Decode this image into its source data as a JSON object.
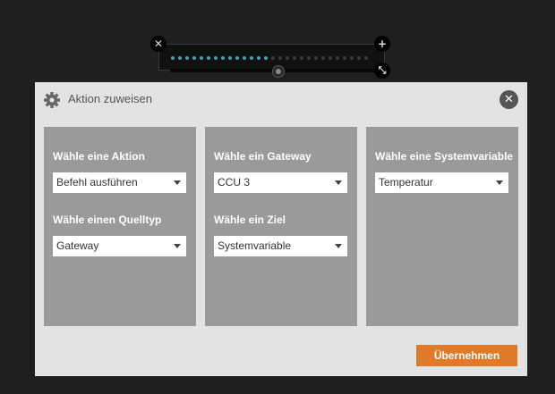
{
  "widget": {
    "dots_total": 28,
    "dots_active": 14,
    "slider_value": 0.5,
    "close_icon": "✕",
    "add_icon": "+",
    "resize_icon": "⤡"
  },
  "dialog": {
    "title": "Aktion zuweisen",
    "close_icon": "✕",
    "apply_label": "Übernehmen",
    "accent_color": "#e07a28"
  },
  "panels": [
    {
      "fields": [
        {
          "label": "Wähle eine Aktion",
          "value": "Befehl ausführen"
        },
        {
          "label": "Wähle einen Quelltyp",
          "value": "Gateway"
        }
      ]
    },
    {
      "fields": [
        {
          "label": "Wähle ein Gateway",
          "value": "CCU 3"
        },
        {
          "label": "Wähle ein Ziel",
          "value": "Systemvariable"
        }
      ]
    },
    {
      "fields": [
        {
          "label": "Wähle eine Systemvariable",
          "value": "Temperatur"
        }
      ]
    }
  ]
}
